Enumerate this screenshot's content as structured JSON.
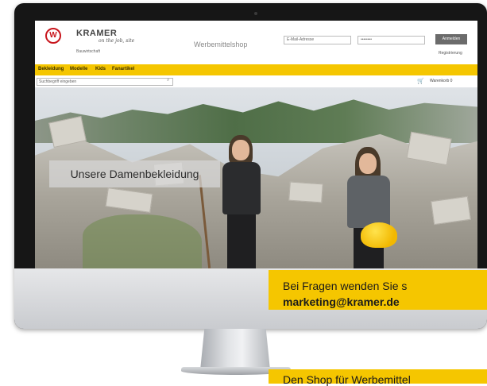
{
  "shop": {
    "brand_name": "KRAMER",
    "tagline": "on the job, site",
    "brand_sub": "Bauwirtschaft",
    "title": "Werbemittelshop",
    "email_placeholder": "E-Mail-Adresse",
    "password_placeholder": "••••••••",
    "login_label": "Anmelden",
    "register_label": "Registrierung",
    "nav": [
      "Bekleidung",
      "Modelle",
      "Kids",
      "Fanartikel"
    ],
    "search_placeholder": "Suchbegriff eingeben",
    "cart_label": "Warenkorb 0"
  },
  "hero": {
    "caption": "Unsere Damenbekleidung"
  },
  "callouts": {
    "question_text": "Bei Fragen wenden Sie s",
    "email": "marketing@kramer.de",
    "shop_text": "Den Shop für Werbemittel"
  },
  "colors": {
    "accent_yellow": "#f5c600",
    "brand_red": "#c8161d"
  }
}
